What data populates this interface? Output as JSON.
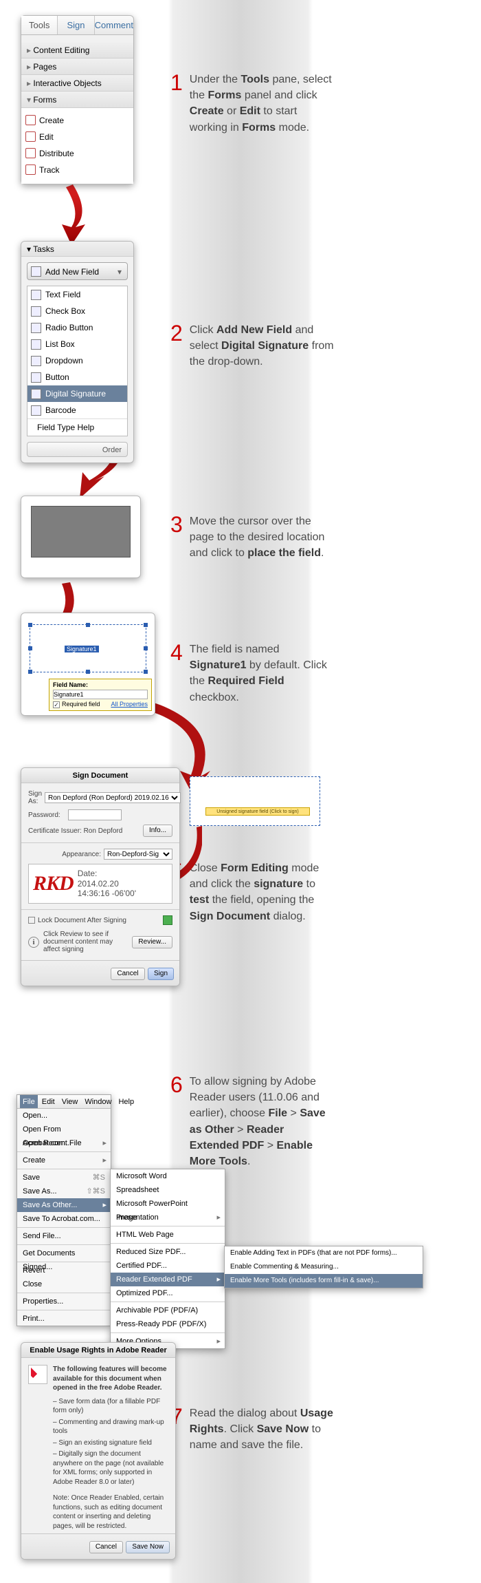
{
  "toolspane": {
    "tabs": [
      "Tools",
      "Sign",
      "Comment"
    ],
    "sections": {
      "content_editing": "Content Editing",
      "pages": "Pages",
      "interactive_objects": "Interactive Objects",
      "forms": "Forms"
    },
    "forms_items": {
      "create": "Create",
      "edit": "Edit",
      "distribute": "Distribute",
      "track": "Track"
    }
  },
  "tasks": {
    "header": "Tasks",
    "add_new_field": "Add New Field",
    "fields": {
      "text": "Text Field",
      "checkbox": "Check Box",
      "radio": "Radio Button",
      "listbox": "List Box",
      "dropdown": "Dropdown",
      "button": "Button",
      "digital_sig": "Digital Signature",
      "barcode": "Barcode"
    },
    "field_type_help": "Field Type Help",
    "order": "    Order"
  },
  "sigfield": {
    "label": "Signature1",
    "fn_title": "Field Name:",
    "fn_value": "Signature1",
    "required_label": "Required field",
    "all_props": "All Properties"
  },
  "signdoc": {
    "title": "Sign Document",
    "sign_as_label": "Sign As:",
    "sign_as_value": "Ron Depford (Ron Depford) 2019.02.16",
    "password_label": "Password:",
    "cert_issuer_label": "Certificate Issuer: Ron Depford",
    "info_btn": "Info...",
    "appearance_label": "Appearance:",
    "appearance_value": "Ron-Depford-Sig",
    "monogram": "RKD",
    "date_label": "Date:",
    "date_value": "2014.02.20",
    "time_value": "14:36:16 -06'00'",
    "lock_label": "Lock Document After Signing",
    "review_text": "Click Review to see if document content may affect signing",
    "review_btn": "Review...",
    "cancel": "Cancel",
    "sign": "Sign"
  },
  "unsigned": {
    "band": "Unsigned signature field (Click to sign)"
  },
  "filemenu": {
    "bar": [
      "File",
      "Edit",
      "View",
      "Window",
      "Help"
    ],
    "items": {
      "open": "Open...",
      "open_from_acrobat": "Open From Acrobat.com...",
      "open_recent": "Open Recent File",
      "create": "Create",
      "save": "Save",
      "save_as": "Save As...",
      "save_as_other": "Save As Other...",
      "save_to_acrobat": "Save To Acrobat.com...",
      "send_file": "Send File...",
      "get_docs_signed": "Get Documents Signed...",
      "revert": "Revert",
      "close": "Close",
      "properties": "Properties...",
      "print": "Print...",
      "save_shortcut": "⌘S",
      "saveas_shortcut": "⇧⌘S"
    },
    "sub2": {
      "ms_word": "Microsoft Word",
      "spreadsheet": "Spreadsheet",
      "ppt": "Microsoft PowerPoint Presentation",
      "image": "Image",
      "html": "HTML Web Page",
      "reduced": "Reduced Size PDF...",
      "certified": "Certified PDF...",
      "reader_ext": "Reader Extended PDF",
      "optimized": "Optimized PDF...",
      "archivable": "Archivable PDF (PDF/A)",
      "pressready": "Press-Ready PDF (PDF/X)",
      "more": "More Options"
    },
    "sub3": {
      "enable_text": "Enable Adding Text in PDFs (that are not PDF forms)...",
      "enable_comment": "Enable Commenting & Measuring...",
      "enable_more": "Enable More Tools (includes form fill-in & save)..."
    }
  },
  "usagerights": {
    "title": "Enable Usage Rights in Adobe Reader",
    "intro": "The following features will become available for this document when opened in the free Adobe Reader.",
    "items": [
      "– Save form data (for a fillable PDF form only)",
      "– Commenting and drawing mark-up tools",
      "– Sign an existing signature field",
      "– Digitally sign the document anywhere on the page (not available for XML forms; only supported in Adobe Reader 8.0 or later)"
    ],
    "note_label": "Note:",
    "note": " Once Reader Enabled, certain functions, such as editing document content or inserting and deleting pages, will be restricted.",
    "cancel": "Cancel",
    "save_now": "Save Now"
  },
  "steps": {
    "s1": "Under the <b>Tools</b> pane, select the <b>Forms</b> panel and click <b>Create</b> or <b>Edit</b> to start working in <b>Forms</b> mode.",
    "s2": "Click <b>Add New Field</b> and select <b>Digital Signature</b> from the drop-down.",
    "s3": "Move the cursor over the page to the desired location and click to <b>place the field</b>.",
    "s4": " The field is named <b>Signature1</b> by default. Click the <b>Required Field</b> checkbox.",
    "s5": "Close <b>Form Editing</b> mode and click the <b>signature</b> to <b>test</b> the field, opening the <b>Sign Document</b> dialog.",
    "s6": "To allow signing by Adobe Reader users (11.0.06 and earlier), choose <b>File</b> > <b>Save as Other</b> > <b>Reader Extended PDF</b> > <b>Enable More Tools</b>.",
    "s7": "Read the dialog about <b>Usage Rights</b>. Click <b>Save Now</b> to name and save the file."
  }
}
